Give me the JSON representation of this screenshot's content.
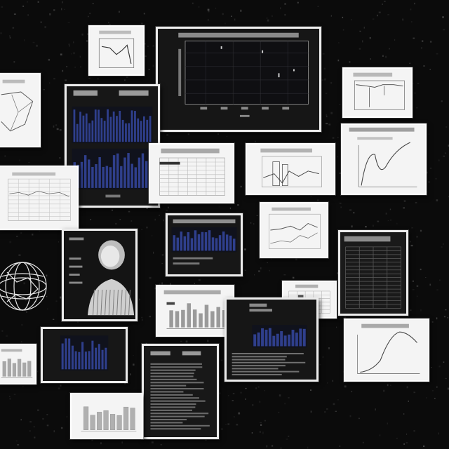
{
  "scene": {
    "background_color": "#0b0b0b",
    "card_light_color": "#f4f4f4",
    "card_dark_color": "#1c1c1c",
    "accent_blue": "#2f3f8c"
  },
  "cards": [
    {
      "name": "card-small-line-chart",
      "kind": "line-light"
    },
    {
      "name": "card-large-dark-line-chart",
      "kind": "dark-plot"
    },
    {
      "name": "card-line-chart-top-right",
      "kind": "line-light"
    },
    {
      "name": "card-pie-diagram-left",
      "kind": "diagram-light"
    },
    {
      "name": "card-dark-bar-dashboard",
      "kind": "dark-bars"
    },
    {
      "name": "card-table-sheet-left",
      "kind": "table-light"
    },
    {
      "name": "card-table-sheet-center",
      "kind": "table-light"
    },
    {
      "name": "card-mixed-chart-center",
      "kind": "line-light"
    },
    {
      "name": "card-curve-chart-right",
      "kind": "curve-light"
    },
    {
      "name": "card-bar-chart-mid",
      "kind": "bars-light"
    },
    {
      "name": "card-dark-bars-center",
      "kind": "dark-bars"
    },
    {
      "name": "card-portrait-dark",
      "kind": "portrait"
    },
    {
      "name": "card-dark-table-right",
      "kind": "dark-table"
    },
    {
      "name": "card-bar-chart-lower",
      "kind": "bars-light"
    },
    {
      "name": "card-small-table",
      "kind": "table-light"
    },
    {
      "name": "card-dark-list-center",
      "kind": "dark-bars"
    },
    {
      "name": "card-curve-chart-lower-right",
      "kind": "curve-light"
    },
    {
      "name": "card-bar-chart-bottom-left",
      "kind": "bars-light"
    },
    {
      "name": "card-dark-bars-bottom",
      "kind": "dark-bars"
    },
    {
      "name": "card-dark-document-bottom",
      "kind": "dark-table"
    },
    {
      "name": "card-bar-chart-bottom",
      "kind": "bars-light"
    },
    {
      "name": "globe-wireframe",
      "kind": "globe"
    }
  ]
}
